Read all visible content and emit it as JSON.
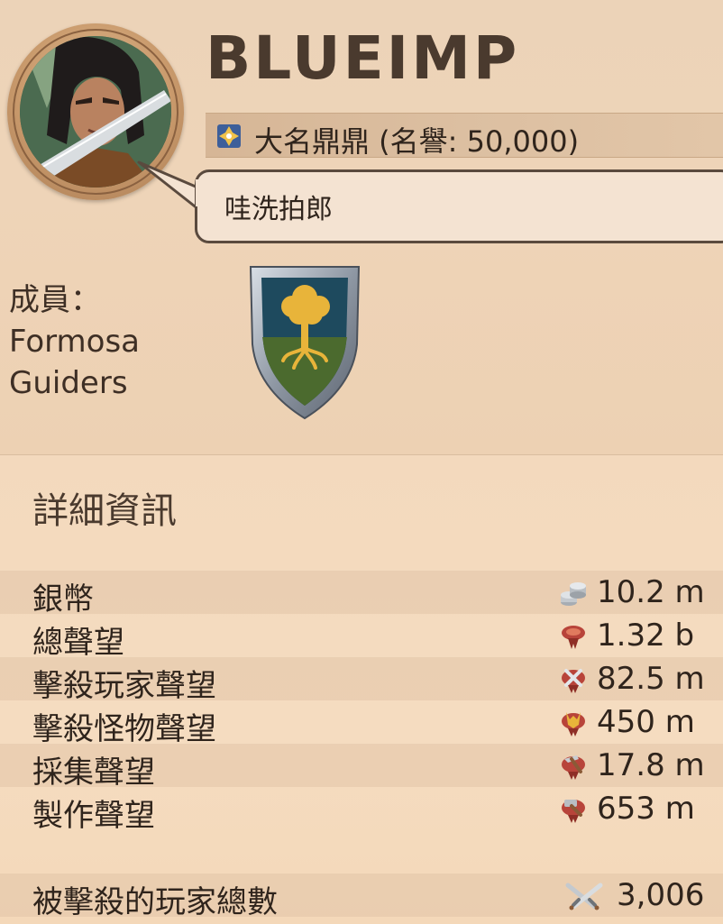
{
  "profile": {
    "name": "BLUEIMP",
    "title": "大名鼎鼎 (名譽: 50,000)",
    "motto": "哇洗拍郎",
    "membership_label": "成員：",
    "guild_line1": "Formosa",
    "guild_line2": "Guiders"
  },
  "details": {
    "section_title": "詳細資訊",
    "rows": [
      {
        "label": "銀幣",
        "value": "10.2 m",
        "icon": "silver-coins-icon"
      },
      {
        "label": "總聲望",
        "value": "1.32 b",
        "icon": "fame-icon"
      },
      {
        "label": "擊殺玩家聲望",
        "value": "82.5 m",
        "icon": "pvp-fame-icon"
      },
      {
        "label": "擊殺怪物聲望",
        "value": "450 m",
        "icon": "pve-fame-icon"
      },
      {
        "label": "採集聲望",
        "value": "17.8 m",
        "icon": "gathering-fame-icon"
      },
      {
        "label": "製作聲望",
        "value": "653 m",
        "icon": "crafting-fame-icon"
      }
    ],
    "kills": {
      "label": "被擊殺的玩家總數",
      "value": "3,006",
      "icon": "crossed-swords-icon"
    }
  },
  "colors": {
    "accent_gold": "#e8b43a",
    "shield_blue": "#1e4a5e",
    "shield_green": "#4b6a2e",
    "text_dark": "#2f241c"
  }
}
